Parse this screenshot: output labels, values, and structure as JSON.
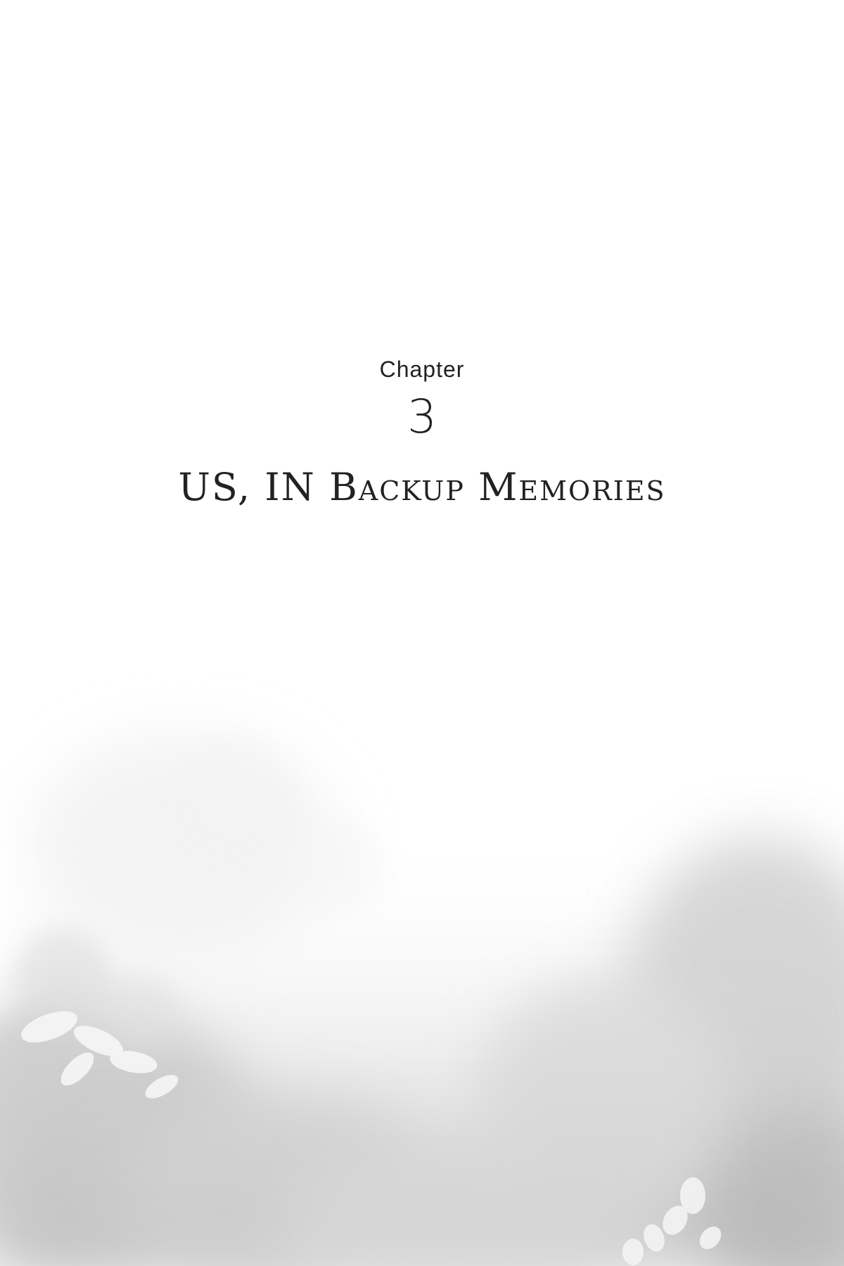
{
  "chapter": {
    "label": "Chapter",
    "number": "3",
    "title": "US, IN Backup Memories"
  },
  "colors": {
    "background": "#ffffff",
    "text": "#222222",
    "art_light": "#eeeeee",
    "art_mid": "#d2d2d2",
    "art_dark": "#b8b8b8"
  }
}
